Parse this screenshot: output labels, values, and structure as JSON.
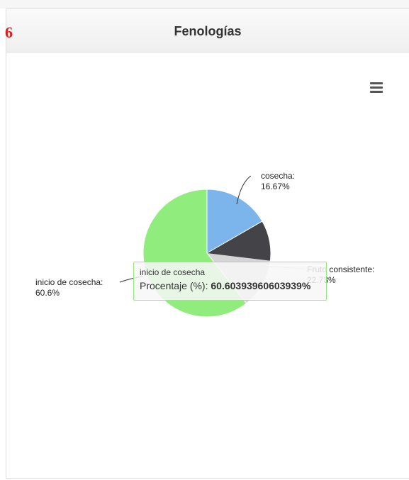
{
  "panel": {
    "title": "Fenologías",
    "corner_glyph": "6"
  },
  "menu": {
    "icon": "hamburger-menu-icon"
  },
  "tooltip": {
    "title": "inicio de cosecha",
    "series_label": "Procentaje (%): ",
    "value_text": "60.60393960603939%"
  },
  "chart_data": {
    "type": "pie",
    "categories": [
      "cosecha",
      "Fruto consistente",
      "inicio de cosecha"
    ],
    "values": [
      16.67,
      22.73,
      60.6
    ],
    "colors": [
      "#7cb5ec",
      "#434348",
      "#90ed7d"
    ],
    "series": [
      {
        "name": "Procentaje (%)",
        "values": [
          16.67,
          22.73,
          60.6
        ]
      }
    ],
    "data_labels": [
      {
        "name": "cosecha:",
        "value": "16.67%"
      },
      {
        "name": "Fruto consistente:",
        "value": "22.73%"
      },
      {
        "name": "inicio de cosecha:",
        "value": "60.6%"
      }
    ],
    "hovered_index": 2
  }
}
